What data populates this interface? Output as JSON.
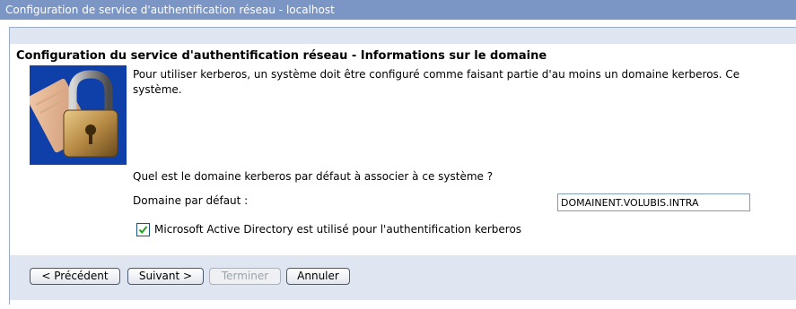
{
  "window": {
    "title": "Configuration de service d'authentification réseau - localhost"
  },
  "page": {
    "title": "Configuration du service d'authentification réseau - Informations sur le domaine",
    "description": "Pour utiliser kerberos, un système doit être configuré comme faisant partie d'au moins un domaine kerberos. Ce système.",
    "description_line1": "Pour utiliser kerberos, un système doit être configuré comme faisant partie d'au moins un domaine kerberos. Ce",
    "description_line2": "système.",
    "image_icon": "padlock-icon"
  },
  "form": {
    "question": "Quel est le domaine kerberos par défaut à associer à ce système ?",
    "domain_label": "Domaine par défaut :",
    "domain_value": "DOMAINENT.VOLUBIS.INTRA",
    "ad_checkbox_label": "Microsoft Active Directory est utilisé pour l'authentification kerberos",
    "ad_checkbox_checked": true
  },
  "buttons": {
    "previous": "< Précédent",
    "next": "Suivant >",
    "finish": "Terminer",
    "cancel": "Annuler"
  },
  "colors": {
    "titlebar": "#7b96c4",
    "panel": "#dfe6f2",
    "image_bg": "#0f3fa8"
  }
}
